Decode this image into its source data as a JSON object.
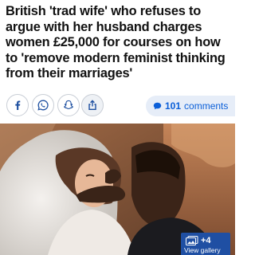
{
  "article": {
    "headline": "British 'trad wife' who refuses to argue with her husband charges women £25,000 for courses on how to 'remove modern feminist thinking from their marriages'"
  },
  "share": {
    "buttons": [
      {
        "icon": "facebook-icon"
      },
      {
        "icon": "whatsapp-icon"
      },
      {
        "icon": "snapchat-icon"
      },
      {
        "icon": "share-icon"
      }
    ]
  },
  "comments": {
    "count": "101",
    "label": "comments"
  },
  "gallery": {
    "count": "+4",
    "label": "View gallery"
  },
  "colors": {
    "accent_blue": "#0b5fd8",
    "gallery_blue": "#1f4fa3",
    "comments_bg": "#e6edf8"
  }
}
